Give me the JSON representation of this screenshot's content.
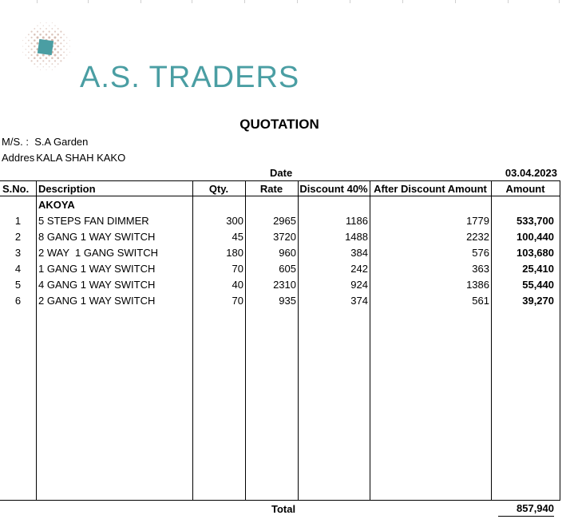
{
  "company": {
    "name": "A.S. TRADERS"
  },
  "title": "QUOTATION",
  "customer": {
    "ms_label": "M/S. :",
    "ms_value": "S.A Garden",
    "address_label": "Addres",
    "address_value": "KALA SHAH KAKO"
  },
  "date": {
    "label": "Date",
    "value": "03.04.2023"
  },
  "table": {
    "headers": [
      "S.No.",
      "Description",
      "Qty.",
      "Rate",
      "Discount 40%",
      "After Discount Amount",
      "Amount"
    ],
    "group": "AKOYA",
    "rows": [
      {
        "sno": "1",
        "desc": "5 STEPS FAN DIMMER",
        "qty": "300",
        "rate": "2965",
        "discount": "1186",
        "after": "1779",
        "amount": "533,700"
      },
      {
        "sno": "2",
        "desc": "8 GANG 1 WAY SWITCH",
        "qty": "45",
        "rate": "3720",
        "discount": "1488",
        "after": "2232",
        "amount": "100,440"
      },
      {
        "sno": "3",
        "desc": "2 WAY  1 GANG SWITCH",
        "qty": "180",
        "rate": "960",
        "discount": "384",
        "after": "576",
        "amount": "103,680"
      },
      {
        "sno": "4",
        "desc": "1 GANG 1 WAY SWITCH",
        "qty": "70",
        "rate": "605",
        "discount": "242",
        "after": "363",
        "amount": "25,410"
      },
      {
        "sno": "5",
        "desc": "4 GANG 1 WAY SWITCH",
        "qty": "40",
        "rate": "2310",
        "discount": "924",
        "after": "1386",
        "amount": "55,440"
      },
      {
        "sno": "6",
        "desc": "2 GANG 1 WAY SWITCH",
        "qty": "70",
        "rate": "935",
        "discount": "374",
        "after": "561",
        "amount": "39,270"
      }
    ],
    "total_label": "Total",
    "total_value": "857,940"
  },
  "colors": {
    "brand": "#4a9ea3",
    "logo_dots": "#c9a79a"
  }
}
